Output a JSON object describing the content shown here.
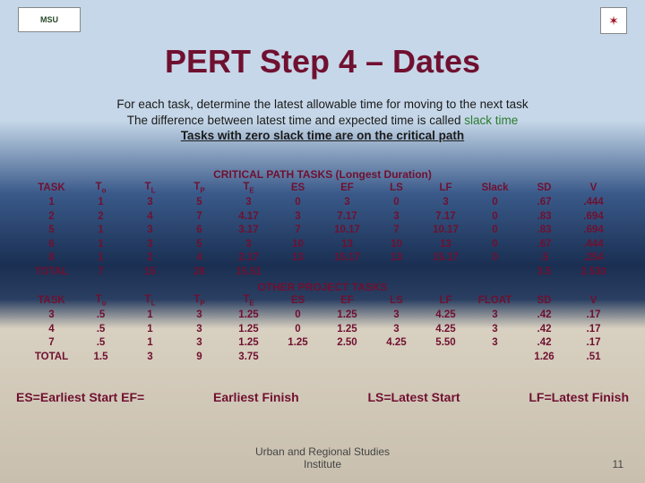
{
  "logos": {
    "left_text": "MSU",
    "right_text": "✶"
  },
  "title": "PERT Step 4 – Dates",
  "intro": {
    "line1": "For each task, determine the latest allowable time for moving to the next task",
    "line2a": "The difference between latest time and expected time is called ",
    "line2b": "slack time",
    "line3": "Tasks with zero slack time are on the critical path"
  },
  "section1_title": "CRITICAL PATH TASKS  (Longest Duration)",
  "section2_title": "OTHER PROJECT TASKS",
  "headers1": [
    "TASK",
    "T",
    "T",
    "T",
    "T",
    "ES",
    "EF",
    "LS",
    "LF",
    "Slack",
    "SD",
    "V"
  ],
  "sub1": [
    "",
    "o",
    "L",
    "P",
    "E",
    "",
    "",
    "",
    "",
    "",
    "",
    ""
  ],
  "critical_rows": [
    [
      "1",
      "1",
      "3",
      "5",
      "3",
      "0",
      "3",
      "0",
      "3",
      "0",
      ".67",
      ".444"
    ],
    [
      "2",
      "2",
      "4",
      "7",
      "4.17",
      "3",
      "7.17",
      "3",
      "7.17",
      "0",
      ".83",
      ".694"
    ],
    [
      "5",
      "1",
      "3",
      "6",
      "3.17",
      "7",
      "10.17",
      "7",
      "10.17",
      "0",
      ".83",
      ".694"
    ],
    [
      "6",
      "1",
      "3",
      "5",
      "3",
      "10",
      "13",
      "10",
      "13",
      "0",
      ".67",
      ".444"
    ],
    [
      "8",
      "1",
      "2",
      "4",
      "2.17",
      "13",
      "15.17",
      "13",
      "15.17",
      "0",
      ".5",
      ".254"
    ],
    [
      "TOTAL",
      "7",
      "15",
      "28",
      "15.51",
      "",
      "",
      "",
      "",
      "",
      "3.5",
      "2.530"
    ]
  ],
  "headers2": [
    "TASK",
    "T",
    "T",
    "T",
    "T",
    "ES",
    "EF",
    "LS",
    "LF",
    "FLOAT",
    "SD",
    "V"
  ],
  "sub2": [
    "",
    "o",
    "L",
    "P",
    "E",
    "",
    "",
    "",
    "",
    "",
    "",
    ""
  ],
  "other_rows": [
    [
      "3",
      ".5",
      "1",
      "3",
      "1.25",
      "0",
      "1.25",
      "3",
      "4.25",
      "3",
      ".42",
      ".17"
    ],
    [
      "4",
      ".5",
      "1",
      "3",
      "1.25",
      "0",
      "1.25",
      "3",
      "4.25",
      "3",
      ".42",
      ".17"
    ],
    [
      "7",
      ".5",
      "1",
      "3",
      "1.25",
      "1.25",
      "2.50",
      "4.25",
      "5.50",
      "3",
      ".42",
      ".17"
    ],
    [
      "TOTAL",
      "1.5",
      "3",
      "9",
      "3.75",
      "",
      "",
      "",
      "",
      "",
      "1.26",
      ".51"
    ]
  ],
  "legend": {
    "a": "ES=Earliest Start EF=",
    "b": "Earliest Finish",
    "c": "LS=Latest Start",
    "d": "LF=Latest Finish"
  },
  "footer1": "Urban and Regional Studies",
  "footer2": "Institute",
  "pagenum": "11"
}
